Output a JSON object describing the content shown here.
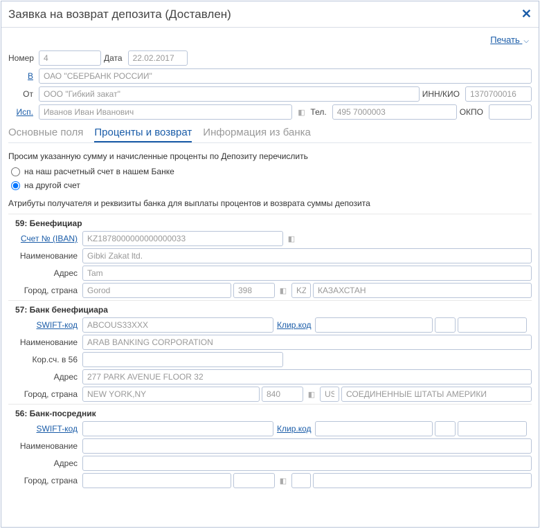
{
  "dialog": {
    "title": "Заявка на возврат депозита (Доставлен)"
  },
  "print_link": "Печать",
  "header": {
    "number_label": "Номер",
    "number": "4",
    "date_label": "Дата",
    "date": "22.02.2017",
    "v_label": "В",
    "v_value": "ОАО \"СБЕРБАНК РОССИИ\"",
    "ot_label": "От",
    "ot_value": "ООО \"Гибкий закат\"",
    "inn_label": "ИНН/КИО",
    "inn_value": "1370700016",
    "isp_label": "Исп.",
    "isp_value": "Иванов Иван Иванович",
    "tel_label": "Тел.",
    "tel_value": "495 7000003",
    "okpo_label": "ОКПО",
    "okpo_value": ""
  },
  "tabs": {
    "main": "Основные поля",
    "interest": "Проценты и возврат",
    "bank_info": "Информация из банка"
  },
  "request_text": "Просим указанную сумму и начисленные проценты по Депозиту перечислить",
  "radio": {
    "our_account": "на наш расчетный счет в нашем Банке",
    "other_account": "на другой счет"
  },
  "attributes_text": "Атрибуты получателя и реквизиты банка для выплаты процентов и возврата суммы депозита",
  "beneficiary": {
    "title": "59: Бенефициар",
    "iban_label": "Счет № (IBAN)",
    "iban": "KZ1878000000000000033",
    "name_label": "Наименование",
    "name": "Gibki Zakat ltd.",
    "address_label": "Адрес",
    "address": "Tam",
    "city_label": "Город, страна",
    "city": "Gorod",
    "code": "398",
    "country_code": "KZ",
    "country": "КАЗАХСТАН"
  },
  "beneficiary_bank": {
    "title": "57: Банк бенефициара",
    "swift_label": "SWIFT-код",
    "swift": "ABCOUS33XXX",
    "clearing_label": "Клир.код",
    "clearing": "",
    "name_label": "Наименование",
    "name": "ARAB BANKING CORPORATION",
    "corr_label": "Кор.сч. в 56",
    "corr": "",
    "address_label": "Адрес",
    "address": "277 PARK AVENUE FLOOR 32",
    "city_label": "Город, страна",
    "city": "NEW YORK,NY",
    "code": "840",
    "country_code": "US",
    "country": "СОЕДИНЕННЫЕ ШТАТЫ АМЕРИКИ"
  },
  "intermediary_bank": {
    "title": "56: Банк-посредник",
    "swift_label": "SWIFT-код",
    "swift": "",
    "clearing_label": "Клир.код",
    "clearing": "",
    "name_label": "Наименование",
    "name": "",
    "address_label": "Адрес",
    "address": "",
    "city_label": "Город, страна",
    "city": "",
    "code": "",
    "country_code": "",
    "country": ""
  }
}
